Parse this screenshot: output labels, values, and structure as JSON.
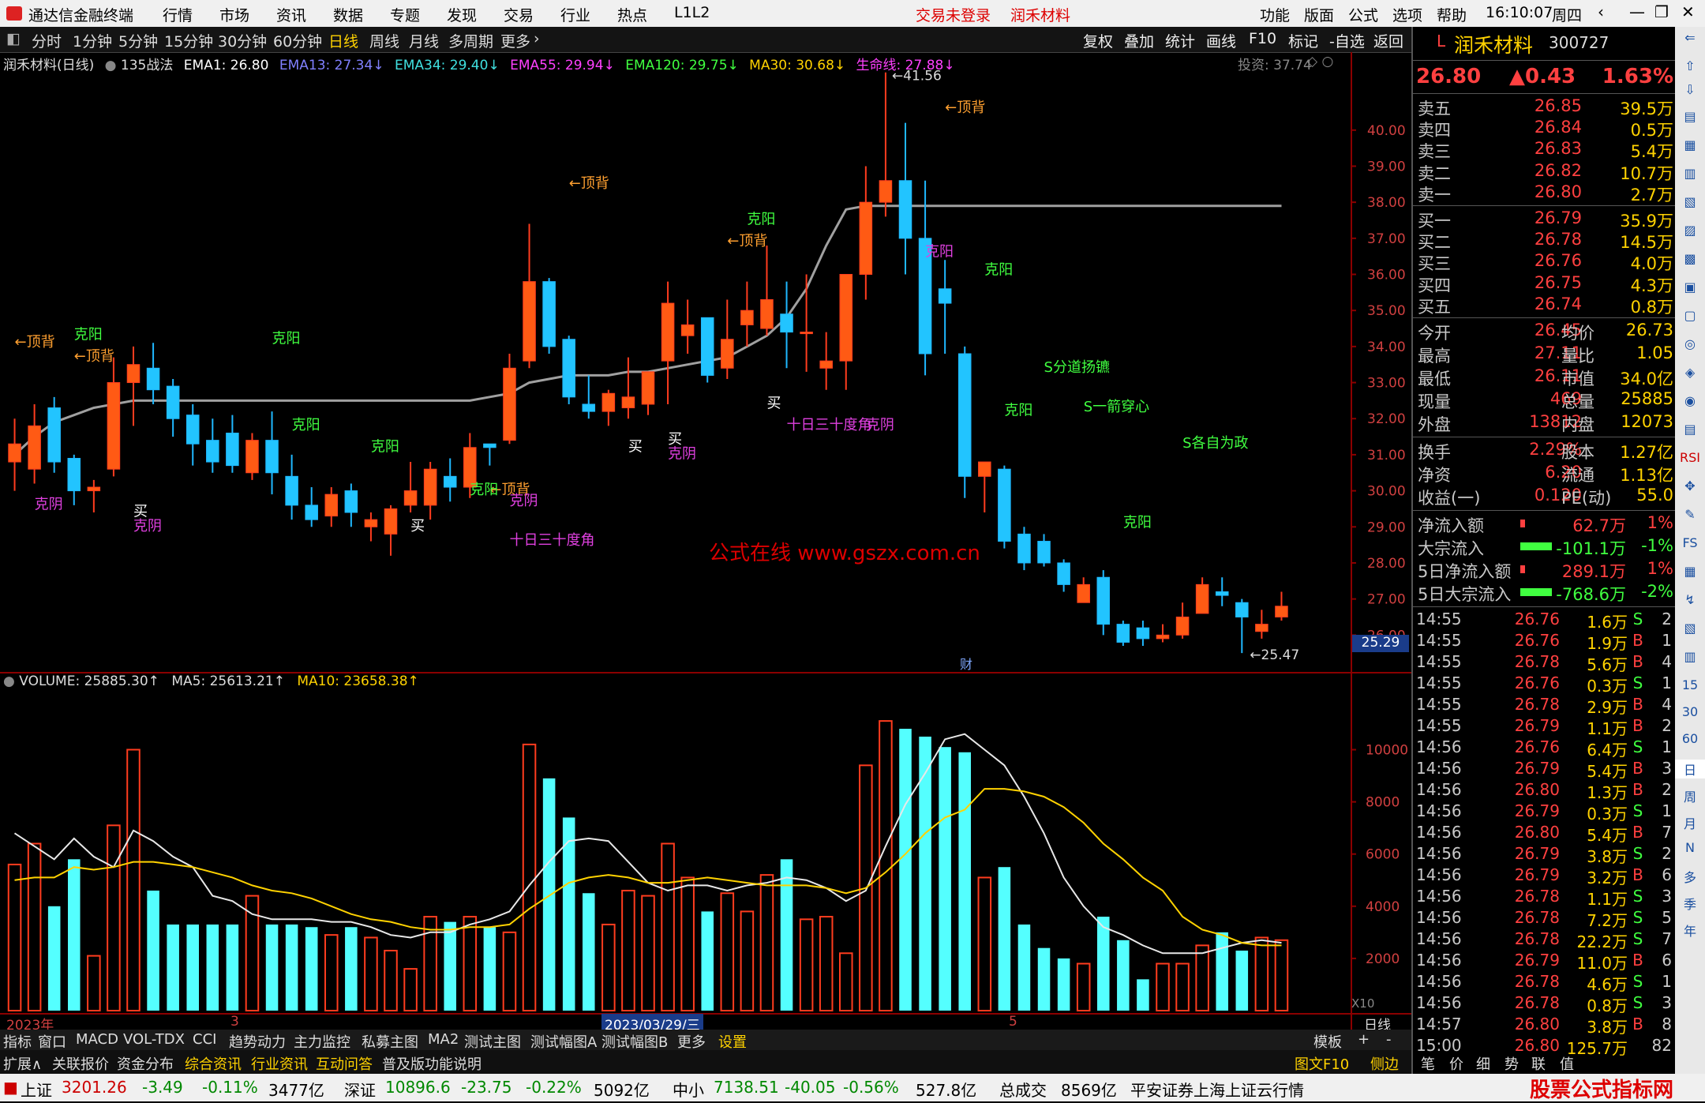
{
  "app": {
    "title": "通达信金融终端",
    "menus": [
      "行情",
      "市场",
      "资讯",
      "数据",
      "专题",
      "发现",
      "交易",
      "行业",
      "热点",
      "L1L2"
    ],
    "trade_status": "交易未登录",
    "stock_name": "润禾材料",
    "right_menus": [
      "功能",
      "版面",
      "公式",
      "选项",
      "帮助"
    ],
    "time": "16:10:07",
    "weekday": "周四"
  },
  "periods": [
    "分时",
    "1分钟",
    "5分钟",
    "15分钟",
    "30分钟",
    "60分钟",
    "日线",
    "周线",
    "月线",
    "多周期",
    "更多"
  ],
  "active_period": "日线",
  "toolbar_right": [
    "复权",
    "叠加",
    "统计",
    "画线",
    "F10",
    "标记",
    "-自选",
    "返回"
  ],
  "main_chart": {
    "label": "润禾材料(日线)",
    "formula": "135战法",
    "ema1": "EMA1: 26.80",
    "ema13": "EMA13: 27.34↓",
    "ema34": "EMA34: 29.40↓",
    "ema55": "EMA55: 29.94↓",
    "ema120": "EMA120: 29.75↓",
    "ma30": "MA30: 30.68↓",
    "life": "生命线: 27.88↓",
    "invest": "投资: 37.74",
    "high_label": "41.56",
    "low_label": "25.47",
    "current_price_box": "25.29",
    "watermark": "公式在线  www.gszx.com.cn",
    "cai": "财"
  },
  "volume_chart": {
    "volume": "VOLUME: 25885.30↑",
    "ma5": "MA5: 25613.21↑",
    "ma10": "MA10: 23658.38↑",
    "x10": "X10"
  },
  "x_axis": [
    "2023年",
    "3",
    "2023/03/29/三",
    "5",
    "日线"
  ],
  "chart_data": {
    "type": "candlestick",
    "price_axis": [
      40.0,
      39.0,
      38.0,
      37.0,
      36.0,
      35.0,
      34.0,
      33.0,
      32.0,
      31.0,
      30.0,
      29.0,
      28.0,
      27.0,
      26.0
    ],
    "volume_axis": [
      10000,
      8000,
      6000,
      4000,
      2000
    ],
    "candles": [
      [
        30.8,
        32.0,
        31.3,
        30.0
      ],
      [
        30.6,
        32.4,
        31.8,
        30.2
      ],
      [
        32.3,
        32.6,
        30.8,
        30.5
      ],
      [
        30.9,
        31.0,
        30.0,
        29.6
      ],
      [
        30.0,
        30.3,
        30.1,
        29.4
      ],
      [
        30.6,
        33.7,
        33.0,
        30.4
      ],
      [
        33.0,
        34.0,
        33.5,
        31.8
      ],
      [
        33.4,
        34.1,
        32.8,
        32.4
      ],
      [
        32.9,
        33.1,
        32.0,
        31.5
      ],
      [
        32.1,
        32.4,
        31.3,
        30.7
      ],
      [
        31.4,
        32.0,
        30.8,
        30.5
      ],
      [
        31.6,
        32.1,
        30.7,
        30.5
      ],
      [
        30.5,
        31.6,
        31.4,
        30.3
      ],
      [
        31.4,
        32.2,
        30.5,
        29.9
      ],
      [
        30.4,
        31.0,
        29.6,
        29.2
      ],
      [
        29.6,
        30.1,
        29.2,
        29.0
      ],
      [
        29.3,
        30.1,
        29.9,
        29.0
      ],
      [
        30.0,
        30.2,
        29.4,
        29.0
      ],
      [
        29.0,
        29.4,
        29.2,
        28.6
      ],
      [
        28.8,
        29.6,
        29.5,
        28.2
      ],
      [
        29.6,
        30.8,
        30.0,
        29.4
      ],
      [
        29.6,
        30.8,
        30.6,
        29.2
      ],
      [
        30.4,
        30.9,
        30.1,
        29.7
      ],
      [
        30.1,
        31.6,
        31.2,
        29.8
      ],
      [
        31.3,
        31.3,
        31.2,
        30.7
      ],
      [
        31.4,
        33.8,
        33.4,
        31.3
      ],
      [
        33.6,
        37.4,
        35.8,
        33.4
      ],
      [
        35.8,
        35.9,
        34.0,
        33.8
      ],
      [
        34.2,
        34.3,
        32.6,
        32.4
      ],
      [
        32.4,
        33.2,
        32.2,
        32.0
      ],
      [
        32.2,
        32.8,
        32.7,
        31.8
      ],
      [
        32.3,
        33.7,
        32.6,
        32.0
      ],
      [
        32.4,
        33.2,
        33.3,
        32.1
      ],
      [
        33.6,
        35.8,
        35.2,
        32.4
      ],
      [
        34.3,
        35.3,
        34.6,
        33.8
      ],
      [
        34.8,
        34.8,
        33.2,
        33.0
      ],
      [
        33.4,
        35.3,
        34.2,
        33.1
      ],
      [
        34.6,
        35.8,
        35.0,
        34.0
      ],
      [
        34.5,
        36.8,
        35.3,
        34.3
      ],
      [
        34.9,
        35.8,
        34.4,
        33.4
      ],
      [
        34.4,
        36.0,
        34.4,
        33.3
      ],
      [
        33.4,
        34.4,
        33.6,
        32.8
      ],
      [
        33.6,
        35.8,
        36.0,
        32.8
      ],
      [
        36.0,
        39.0,
        38.0,
        35.3
      ],
      [
        38.0,
        41.6,
        38.6,
        37.6
      ],
      [
        38.6,
        40.2,
        37.0,
        36.0
      ],
      [
        37.0,
        38.6,
        33.8,
        33.2
      ],
      [
        35.6,
        36.4,
        35.2,
        33.8
      ],
      [
        33.8,
        34.0,
        30.4,
        29.8
      ],
      [
        30.4,
        30.8,
        30.8,
        29.4
      ],
      [
        30.6,
        30.7,
        28.6,
        28.4
      ],
      [
        28.8,
        29.0,
        28.0,
        27.8
      ],
      [
        28.6,
        28.8,
        28.0,
        27.9
      ],
      [
        28.0,
        28.1,
        27.4,
        27.2
      ],
      [
        26.9,
        27.6,
        27.4,
        26.9
      ],
      [
        27.6,
        27.8,
        26.3,
        26.0
      ],
      [
        26.3,
        26.4,
        25.8,
        25.7
      ],
      [
        26.2,
        26.4,
        25.9,
        25.7
      ],
      [
        25.9,
        26.3,
        26.0,
        25.8
      ],
      [
        26.0,
        26.9,
        26.5,
        25.9
      ],
      [
        26.6,
        27.6,
        27.4,
        26.6
      ],
      [
        27.2,
        27.6,
        27.1,
        26.8
      ],
      [
        26.9,
        27.0,
        26.5,
        25.5
      ],
      [
        26.1,
        26.7,
        26.3,
        25.9
      ],
      [
        26.5,
        27.2,
        26.8,
        26.4
      ]
    ],
    "volumes": [
      5600,
      6400,
      4000,
      5800,
      2100,
      7100,
      10000,
      4600,
      3300,
      3300,
      3300,
      3300,
      4400,
      3300,
      3300,
      3200,
      2900,
      3200,
      2800,
      2300,
      1600,
      3600,
      3400,
      3600,
      3200,
      3000,
      10200,
      8900,
      7400,
      4500,
      3300,
      4600,
      4400,
      6400,
      5100,
      3800,
      4500,
      3800,
      5200,
      5800,
      3500,
      3600,
      2200,
      9400,
      11100,
      10800,
      10500,
      10100,
      9900,
      5100,
      5500,
      3300,
      2400,
      2000,
      1800,
      3600,
      2700,
      1200,
      1800,
      1800,
      2500,
      3000,
      2300,
      2800,
      2700
    ],
    "line_ma30": [
      31.0,
      31.5,
      31.9,
      32.1,
      32.3,
      32.4,
      32.5,
      32.5,
      32.5,
      32.5,
      32.5,
      32.5,
      32.5,
      32.5,
      32.5,
      32.5,
      32.5,
      32.5,
      32.5,
      32.5,
      32.5,
      32.5,
      32.5,
      32.5,
      32.6,
      32.7,
      33.0,
      33.1,
      33.2,
      33.2,
      33.2,
      33.3,
      33.3,
      33.4,
      33.5,
      33.6,
      33.7,
      34.0,
      34.3,
      34.8,
      35.6,
      36.8,
      37.8,
      37.9,
      37.9,
      37.9,
      37.9,
      37.9,
      37.9,
      37.9,
      37.9,
      37.9,
      37.9,
      37.9,
      37.9,
      37.9,
      37.9,
      37.9,
      37.9,
      37.9,
      37.9,
      37.9,
      37.9,
      37.9,
      37.9
    ],
    "vol_ma5": [
      6800,
      6300,
      5800,
      6600,
      5900,
      5500,
      6900,
      6500,
      5900,
      5500,
      4400,
      4200,
      3700,
      3500,
      3500,
      3500,
      3400,
      3400,
      3200,
      2900,
      2800,
      3000,
      3000,
      3300,
      3500,
      3800,
      4800,
      5700,
      6500,
      6600,
      6500,
      5700,
      4900,
      4600,
      4800,
      4800,
      4600,
      4800,
      4900,
      5100,
      5000,
      4700,
      4200,
      4600,
      6300,
      7900,
      9100,
      10400,
      10600,
      10000,
      9400,
      8200,
      6800,
      5100,
      4000,
      3200,
      2900,
      2500,
      2200,
      2200,
      2200,
      2400,
      2600,
      2700,
      2600
    ],
    "vol_ma10": [
      5000,
      5100,
      5100,
      5500,
      5400,
      5500,
      5700,
      5700,
      5600,
      5500,
      5300,
      5100,
      4800,
      4600,
      4500,
      4300,
      4000,
      3700,
      3500,
      3400,
      3200,
      3100,
      3100,
      3200,
      3200,
      3300,
      3900,
      4400,
      4900,
      5100,
      5200,
      5100,
      4900,
      4900,
      5000,
      5100,
      5000,
      4900,
      4800,
      4800,
      4800,
      4700,
      4500,
      4700,
      5300,
      6000,
      6800,
      7400,
      7700,
      8500,
      8500,
      8400,
      8200,
      7800,
      7200,
      6400,
      5800,
      5100,
      4600,
      3600,
      3100,
      2900,
      2600,
      2500,
      2500
    ]
  },
  "quote": {
    "name": "润禾材料",
    "code": "300727",
    "price": "26.80",
    "change": "▲0.43",
    "pct": "1.63%",
    "asks": [
      {
        "label": "卖五",
        "price": "26.85",
        "vol": "39.5万"
      },
      {
        "label": "卖四",
        "price": "26.84",
        "vol": "0.5万"
      },
      {
        "label": "卖三",
        "price": "26.83",
        "vol": "5.4万"
      },
      {
        "label": "卖二",
        "price": "26.82",
        "vol": "10.7万"
      },
      {
        "label": "卖一",
        "price": "26.80",
        "vol": "2.7万"
      }
    ],
    "bids": [
      {
        "label": "买一",
        "price": "26.79",
        "vol": "35.9万"
      },
      {
        "label": "买二",
        "price": "26.78",
        "vol": "14.5万"
      },
      {
        "label": "买三",
        "price": "26.76",
        "vol": "4.0万"
      },
      {
        "label": "买四",
        "price": "26.75",
        "vol": "4.3万"
      },
      {
        "label": "买五",
        "price": "26.74",
        "vol": "0.8万"
      }
    ],
    "stats": [
      {
        "l1": "今开",
        "v1": "26.45",
        "l2": "均价",
        "v2": "26.73"
      },
      {
        "l1": "最高",
        "v1": "27.11",
        "l2": "量比",
        "v2": "1.05"
      },
      {
        "l1": "最低",
        "v1": "26.11",
        "l2": "市值",
        "v2": "34.0亿"
      },
      {
        "l1": "现量",
        "v1": "469",
        "l2": "总量",
        "v2": "25885"
      },
      {
        "l1": "外盘",
        "v1": "13812",
        "l2": "内盘",
        "v2": "12073"
      }
    ],
    "stats2": [
      {
        "l1": "换手",
        "v1": "2.29%",
        "l2": "股本",
        "v2": "1.27亿"
      },
      {
        "l1": "净资",
        "v1": "6.20",
        "l2": "流通",
        "v2": "1.13亿"
      },
      {
        "l1": "收益(一)",
        "v1": "0.120",
        "l2": "PE(动)",
        "v2": "55.0"
      }
    ],
    "flows": [
      {
        "label": "净流入额",
        "val": "62.7万",
        "pct": "1%"
      },
      {
        "label": "大宗流入",
        "val": "-101.1万",
        "pct": "-1%"
      },
      {
        "label": "5日净流入额",
        "val": "289.1万",
        "pct": "1%"
      },
      {
        "label": "5日大宗流入",
        "val": "-768.6万",
        "pct": "-2%"
      }
    ],
    "ticks": [
      [
        "14:55",
        "26.76",
        "1.6万",
        "S",
        "2"
      ],
      [
        "14:55",
        "26.76",
        "1.9万",
        "B",
        "1"
      ],
      [
        "14:55",
        "26.78",
        "5.6万",
        "B",
        "4"
      ],
      [
        "14:55",
        "26.76",
        "0.3万",
        "S",
        "1"
      ],
      [
        "14:55",
        "26.78",
        "2.9万",
        "B",
        "4"
      ],
      [
        "14:55",
        "26.79",
        "1.1万",
        "B",
        "2"
      ],
      [
        "14:56",
        "26.76",
        "6.4万",
        "S",
        "1"
      ],
      [
        "14:56",
        "26.79",
        "5.4万",
        "B",
        "3"
      ],
      [
        "14:56",
        "26.80",
        "1.3万",
        "B",
        "2"
      ],
      [
        "14:56",
        "26.79",
        "0.3万",
        "S",
        "1"
      ],
      [
        "14:56",
        "26.80",
        "5.4万",
        "B",
        "7"
      ],
      [
        "14:56",
        "26.79",
        "3.8万",
        "S",
        "2"
      ],
      [
        "14:56",
        "26.79",
        "3.2万",
        "B",
        "6"
      ],
      [
        "14:56",
        "26.78",
        "1.1万",
        "S",
        "3"
      ],
      [
        "14:56",
        "26.78",
        "7.2万",
        "S",
        "5"
      ],
      [
        "14:56",
        "26.78",
        "22.2万",
        "S",
        "7"
      ],
      [
        "14:56",
        "26.79",
        "11.0万",
        "B",
        "6"
      ],
      [
        "14:56",
        "26.78",
        "4.6万",
        "S",
        "1"
      ],
      [
        "14:56",
        "26.78",
        "0.8万",
        "S",
        "3"
      ],
      [
        "14:57",
        "26.80",
        "3.8万",
        "B",
        "8"
      ],
      [
        "15:00",
        "26.80",
        "125.7万",
        "",
        "82"
      ]
    ]
  },
  "right_strip": [
    "15",
    "30",
    "60",
    "日",
    "周",
    "月",
    "N",
    "多",
    "季",
    "年"
  ],
  "tabs1": [
    "指标",
    "窗口",
    "MACD",
    "VOL-TDX",
    "CCI",
    "趋势动力",
    "主力监控",
    "私募主图",
    "MA2",
    "测试主图",
    "测试幅图A",
    "测试幅图B",
    "更多",
    "设置",
    "模板",
    "+",
    "-"
  ],
  "tabs2": [
    "扩展∧",
    "关联报价",
    "资金分布",
    "综合资讯",
    "行业资讯",
    "互动问答",
    "普及版功能说明"
  ],
  "tabs2_right": [
    "图文F10",
    "侧边栏《",
    "笔",
    "价",
    "细",
    "势",
    "联",
    "值"
  ],
  "status": {
    "sh_label": "上证",
    "sh": "3201.26",
    "sh_chg": "-3.49",
    "sh_pct": "-0.11%",
    "sh_amt": "3477亿",
    "sz_label": "深证",
    "sz": "10896.6",
    "sz_chg": "-23.75",
    "sz_pct": "-0.22%",
    "sz_amt": "5092亿",
    "zx_label": "中小",
    "zx": "7138.51",
    "zx_chg": "-40.05",
    "zx_pct": "-0.56%",
    "zx_amt": "527.8亿",
    "total_label": "总成交",
    "total": "8569亿",
    "broker": "平安证券上海上证云行情",
    "brand": "股票公式指标网",
    "brand_url": "www.gszx.com.cn"
  },
  "annotations": [
    "←顶背",
    "←顶背",
    "克阳",
    "←顶背",
    "克阳",
    "克阳",
    "克阳",
    "克阴",
    "克阴",
    "买",
    "买",
    "←顶背",
    "克阳",
    "←顶背",
    "克阳",
    "克阴",
    "买",
    "买",
    "十日三十度角",
    "克阴",
    "十日三十度角",
    "克阴",
    "买",
    "克阳",
    "←顶背",
    "S分道扬镳",
    "S一箭穿心",
    "S各自为政",
    "克阳",
    "克阳",
    "克阳"
  ]
}
